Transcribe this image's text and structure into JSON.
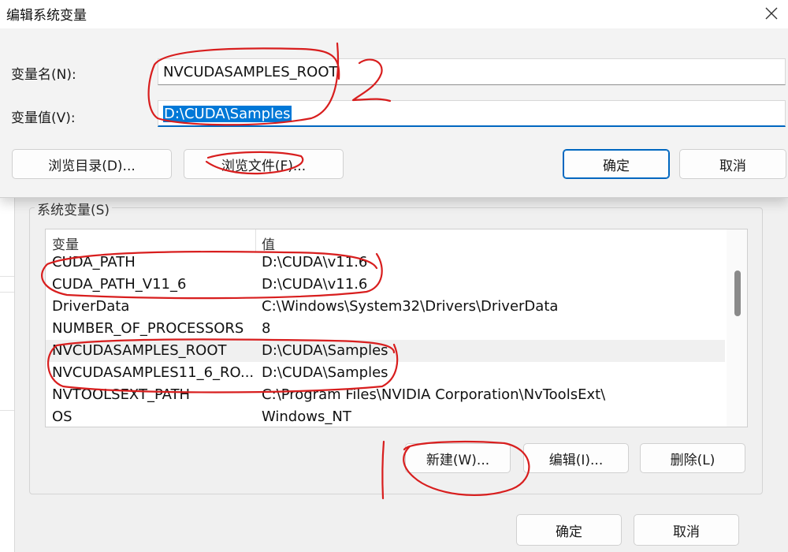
{
  "dialog": {
    "title": "编辑系统变量",
    "name_label": "变量名(N):",
    "name_value": "NVCUDASAMPLES_ROOT",
    "value_label": "变量值(V):",
    "value_value": "D:\\CUDA\\Samples",
    "browse_dir_label": "浏览目录(D)...",
    "browse_file_label": "浏览文件(F)...",
    "ok_label": "确定",
    "cancel_label": "取消"
  },
  "system_vars": {
    "group_label": "系统变量(S)",
    "col_variable": "变量",
    "col_value": "值",
    "rows": [
      {
        "name": "CUDA_PATH",
        "value": "D:\\CUDA\\v11.6"
      },
      {
        "name": "CUDA_PATH_V11_6",
        "value": "D:\\CUDA\\v11.6"
      },
      {
        "name": "DriverData",
        "value": "C:\\Windows\\System32\\Drivers\\DriverData"
      },
      {
        "name": "NUMBER_OF_PROCESSORS",
        "value": "8"
      },
      {
        "name": "NVCUDASAMPLES_ROOT",
        "value": "D:\\CUDA\\Samples"
      },
      {
        "name": "NVCUDASAMPLES11_6_RO...",
        "value": "D:\\CUDA\\Samples"
      },
      {
        "name": "NVTOOLSEXT_PATH",
        "value": "C:\\Program Files\\NVIDIA Corporation\\NvToolsExt\\"
      },
      {
        "name": "OS",
        "value": "Windows_NT"
      }
    ],
    "new_label": "新建(W)...",
    "edit_label": "编辑(I)...",
    "delete_label": "删除(L)"
  },
  "footer": {
    "ok_label": "确定",
    "cancel_label": "取消"
  },
  "colors": {
    "accent": "#0067c0",
    "selection": "#0078d7",
    "annotation": "#d81e1e"
  },
  "icons": {
    "close": "close-icon"
  }
}
